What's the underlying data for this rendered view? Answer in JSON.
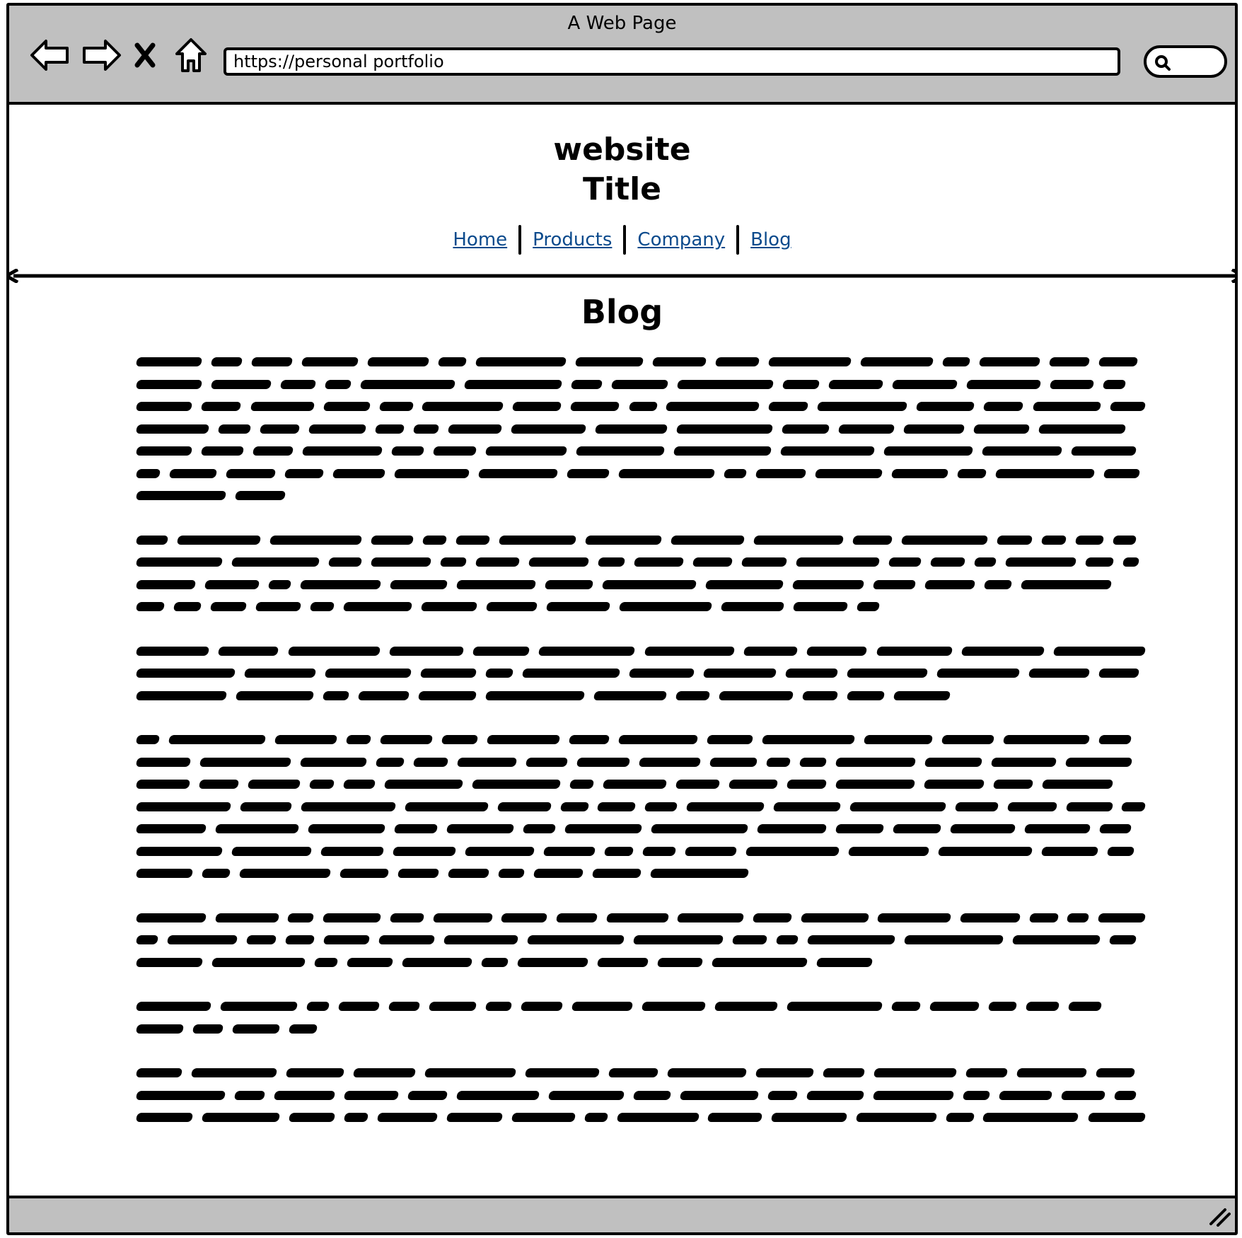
{
  "window": {
    "title": "A Web Page"
  },
  "browser": {
    "url": "https://personal portfolio",
    "nav_icons": [
      "back-arrow-icon",
      "forward-arrow-icon",
      "close-x-icon",
      "home-icon"
    ],
    "search_icon": "search-icon"
  },
  "site": {
    "title_line1": "website",
    "title_line2": "Title",
    "nav": [
      {
        "label": "Home"
      },
      {
        "label": "Products"
      },
      {
        "label": "Company"
      },
      {
        "label": "Blog"
      }
    ],
    "link_color": "#0b4a8c"
  },
  "page": {
    "heading": "Blog",
    "paragraph_line_counts": [
      7,
      4,
      3,
      7,
      3,
      2,
      3
    ],
    "placeholder_text": "scribbled placeholder text"
  },
  "colors": {
    "chrome_gray": "#c0c0c0",
    "ink": "#000000"
  }
}
